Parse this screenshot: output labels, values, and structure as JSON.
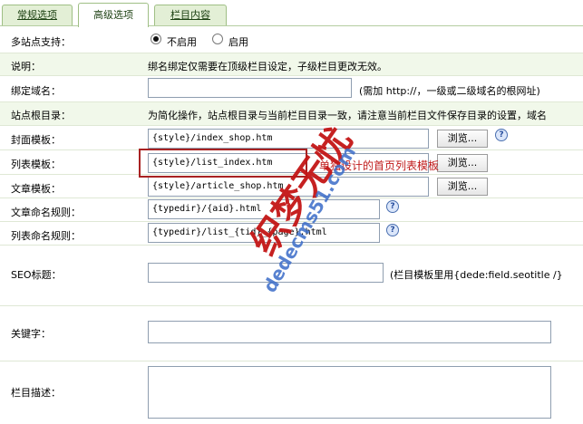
{
  "tabs": [
    {
      "label": "常规选项"
    },
    {
      "label": "高级选项"
    },
    {
      "label": "栏目内容"
    }
  ],
  "multisite": {
    "label": "多站点支持：",
    "option_disabled": "不启用",
    "option_enabled": "启用",
    "selected": "不启用"
  },
  "desc": {
    "label": "说明：",
    "text": "绑名绑定仅需要在顶级栏目设定，子级栏目更改无效。"
  },
  "domain": {
    "label": "绑定域名：",
    "value": "",
    "note": "(需加 http://，一级或二级域名的根网址)"
  },
  "siteroot": {
    "label": "站点根目录：",
    "text": "为简化操作，站点根目录与当前栏目目录一致，请注意当前栏目文件保存目录的设置，域名"
  },
  "cover_tpl": {
    "label": "封面模板：",
    "value": "{style}/index_shop.htm",
    "browse": "浏览..."
  },
  "list_tpl": {
    "label": "列表模板：",
    "value": "{style}/list_index.htm",
    "browse": "浏览..."
  },
  "article_tpl": {
    "label": "文章模板：",
    "value": "{style}/article_shop.htm",
    "browse": "浏览..."
  },
  "article_rule": {
    "label": "文章命名规则：",
    "value": "{typedir}/{aid}.html"
  },
  "list_rule": {
    "label": "列表命名规则：",
    "value": "{typedir}/list_{tid}_{page}.html"
  },
  "seo": {
    "label": "SEO标题：",
    "value": "",
    "note": "(栏目模板里用{dede:field.seotitle /}"
  },
  "keywords": {
    "label": "关键字：",
    "value": ""
  },
  "description": {
    "label": "栏目描述：",
    "value": ""
  },
  "callout": {
    "text": "单独设计的首页列表模板"
  },
  "watermark": {
    "brand": "织梦无忧",
    "url": "dedecms51.com"
  },
  "help_glyph": "?",
  "colors": {
    "tab_bg": "#e3efd6",
    "row_shade": "#f1f8ea",
    "callout": "#c01a1a",
    "highlight_box": "#a82222"
  }
}
